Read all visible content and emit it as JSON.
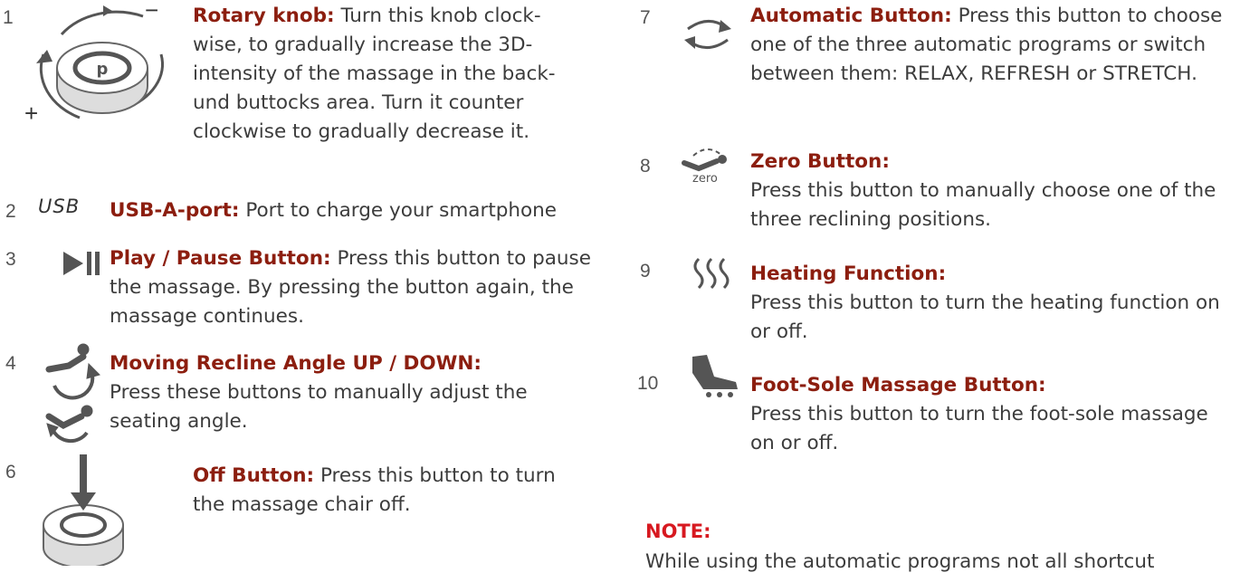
{
  "colors": {
    "title": "#8c1e0f",
    "note": "#d71920",
    "body": "#3c3c3c",
    "icon": "#666666"
  },
  "items": {
    "knob": {
      "num": "1",
      "title": "Rotary knob:",
      "text": "Turn this knob clock-wise, to gradually increase the 3D-intensity of the massage in the back-und buttocks area. Turn it counter clockwise to gradually decrease it.",
      "plus": "+",
      "minus": "−",
      "icon": "rotary-knob-icon"
    },
    "usb": {
      "num": "2",
      "glyph": "USB",
      "title": "USB-A-port:",
      "text": "Port to charge your smartphone"
    },
    "play": {
      "num": "3",
      "title": "Play / Pause Button:",
      "text": "Press this button to pause the massage. By pressing the button again, the massage continues.",
      "icon": "play-pause-icon"
    },
    "recline": {
      "num": "4",
      "title": "Moving Recline Angle UP / DOWN:",
      "text": "Press these buttons to manually adjust the seating angle.",
      "icon": "recline-icon"
    },
    "off": {
      "num": "6",
      "title": "Off Button:",
      "text": "Press this button to turn the massage chair off.",
      "icon": "off-knob-icon"
    },
    "auto": {
      "num": "7",
      "title": "Automatic Button:",
      "text": "Press this button to choose one of the three automatic programs or switch between them: RELAX, REFRESH or STRETCH.",
      "icon": "auto-cycle-icon"
    },
    "zero": {
      "num": "8",
      "glyph": "zero",
      "title": "Zero Button:",
      "text": "Press this button to manually choose one of the three reclining positions.",
      "icon": "zero-gravity-icon"
    },
    "heat": {
      "num": "9",
      "title": "Heating Function:",
      "text": "Press this button to turn the heating function on or off.",
      "icon": "heat-icon"
    },
    "foot": {
      "num": "10",
      "title": "Foot-Sole Massage Button:",
      "text": "Press this button to turn the foot-sole massage on or off.",
      "icon": "foot-roller-icon"
    }
  },
  "note": {
    "title": "NOTE:",
    "text": "While using the automatic programs not all shortcut"
  }
}
